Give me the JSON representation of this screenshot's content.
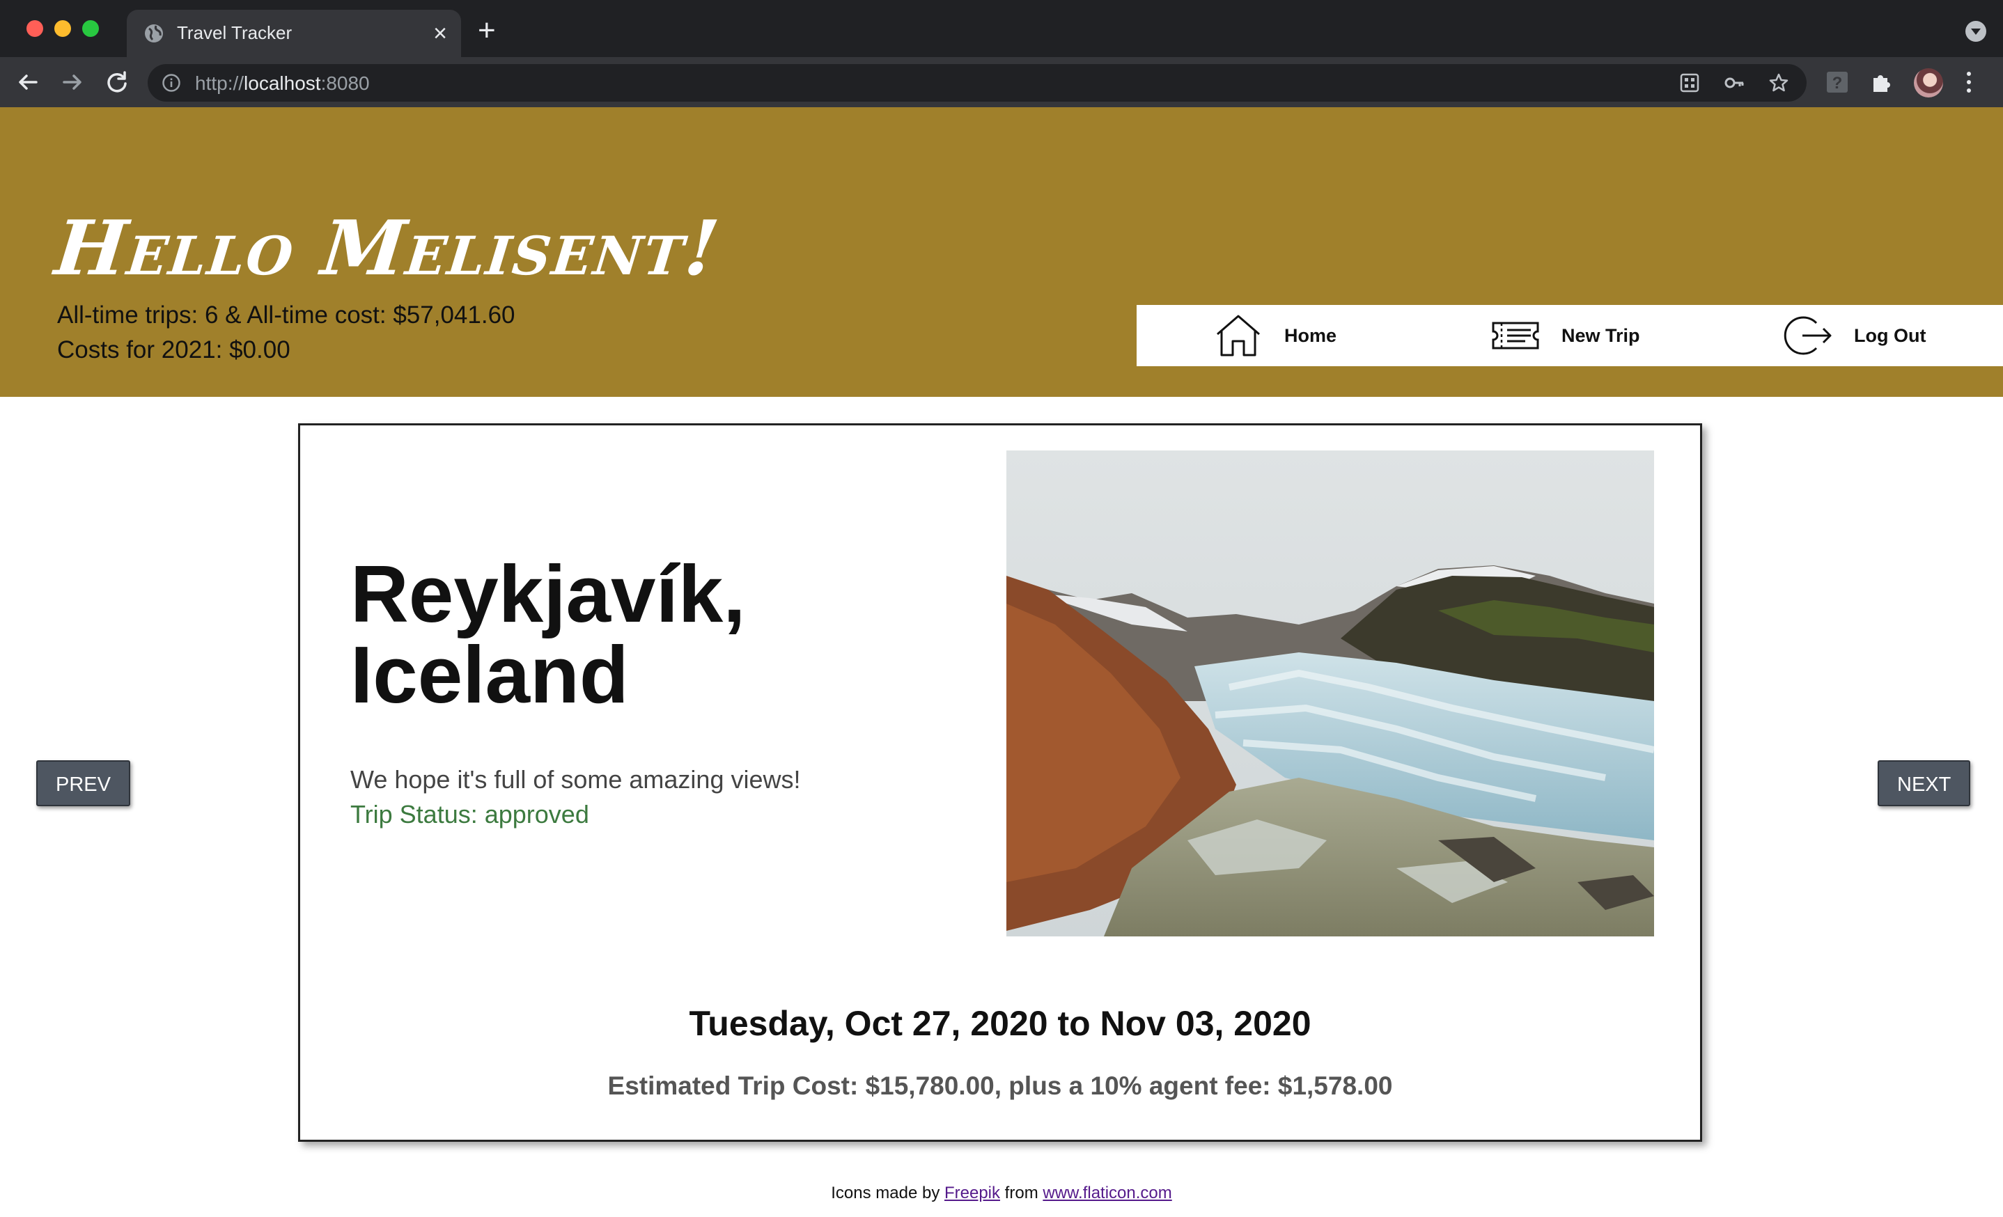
{
  "browser": {
    "tab_title": "Travel Tracker",
    "url_scheme": "http://",
    "url_host": "localhost",
    "url_port": ":8080"
  },
  "header": {
    "greeting": "Hello Melisent!",
    "stats_line1": "All-time trips: 6 & All-time cost: $57,041.60",
    "stats_line2": "Costs for 2021: $0.00",
    "nav": {
      "home": "Home",
      "new_trip": "New Trip",
      "log_out": "Log Out"
    }
  },
  "trip": {
    "destination": "Reykjavík, Iceland",
    "message": "We hope it's full of some amazing views!",
    "status": "Trip Status: approved",
    "dates": "Tuesday, Oct 27, 2020 to Nov 03, 2020",
    "cost": "Estimated Trip Cost: $15,780.00, plus a 10% agent fee: $1,578.00",
    "image_alt": "Glacier between mountains in Iceland"
  },
  "pager": {
    "prev": "PREV",
    "next": "NEXT"
  },
  "footer": {
    "prefix": "Icons made by ",
    "author": "Freepik",
    "middle": " from ",
    "site": "www.flaticon.com"
  },
  "colors": {
    "header_bg": "#a0802b",
    "status_green": "#3c7a3f",
    "button_bg": "#4e5661"
  }
}
